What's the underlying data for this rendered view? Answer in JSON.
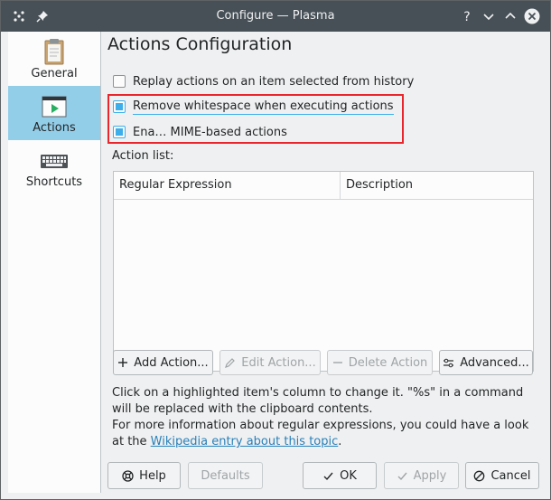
{
  "window": {
    "title": "Configure — Plasma"
  },
  "sidebar": {
    "items": [
      {
        "label": "General",
        "icon": "clipboard-icon",
        "active": false
      },
      {
        "label": "Actions",
        "icon": "run-icon",
        "active": true
      },
      {
        "label": "Shortcuts",
        "icon": "keyboard-icon",
        "active": false
      }
    ]
  },
  "page": {
    "heading": "Actions Configuration",
    "options": [
      {
        "label": "Replay actions on an item selected from history",
        "checked": false
      },
      {
        "label": "Remove whitespace when executing actions",
        "checked": true
      },
      {
        "label": "Ena… MIME-based actions",
        "checked": true
      }
    ],
    "action_list_label": "Action list:",
    "table": {
      "columns": [
        "Regular Expression",
        "Description"
      ],
      "rows": []
    },
    "buttons": {
      "add": "Add Action...",
      "edit": "Edit Action...",
      "delete": "Delete Action",
      "advanced": "Advanced..."
    },
    "info": {
      "line1": "Click on a highlighted item's column to change it. \"%s\" in a command will be replaced with the clipboard contents.",
      "line2_prefix": "For more information about regular expressions, you could have a look at the ",
      "link": "Wikipedia entry about this topic",
      "line2_suffix": "."
    }
  },
  "footer": {
    "help": "Help",
    "defaults": "Defaults",
    "ok": "OK",
    "apply": "Apply",
    "cancel": "Cancel"
  },
  "colors": {
    "accent": "#3daee9",
    "selection": "#93cee9",
    "titlebar": "#475057",
    "annotation": "#e8262b"
  }
}
